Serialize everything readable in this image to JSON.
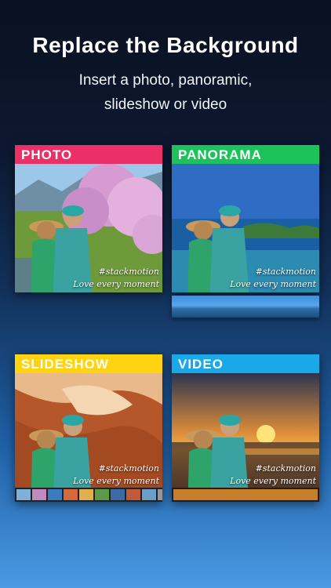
{
  "header": {
    "title": "Replace the Background",
    "subtitle_line1": "Insert a photo, panoramic,",
    "subtitle_line2": "slideshow or video"
  },
  "cards": [
    {
      "label": "PHOTO",
      "color": "#ec2f66",
      "caption_tag": "#stackmotion",
      "caption_line": "Love every moment"
    },
    {
      "label": "PANORAMA",
      "color": "#1bc35a",
      "caption_tag": "#stackmotion",
      "caption_line": "Love every moment"
    },
    {
      "label": "SLIDESHOW",
      "color": "#ffd40f",
      "caption_tag": "#stackmotion",
      "caption_line": "Love every moment"
    },
    {
      "label": "VIDEO",
      "color": "#1aa9e8",
      "caption_tag": "#stackmotion",
      "caption_line": "Love every moment"
    }
  ]
}
